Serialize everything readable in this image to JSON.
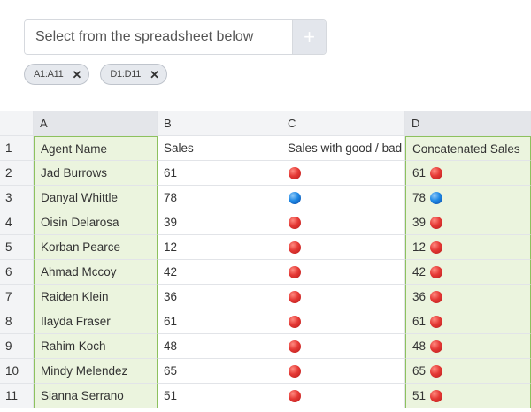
{
  "selector": {
    "placeholder": "Select from the spreadsheet below",
    "add_label": "+"
  },
  "chips": [
    {
      "label": "A1:A11"
    },
    {
      "label": "D1:D11"
    }
  ],
  "columns": [
    "A",
    "B",
    "C",
    "D"
  ],
  "colors": {
    "highlight_fill": "#ebf4de",
    "highlight_border": "#8dc15e",
    "bad": "#e53935",
    "good": "#1e88e5"
  },
  "rows": [
    {
      "num": "1",
      "a": "Agent Name",
      "b": "Sales",
      "c": "Sales with good / bad",
      "d": "Concatenated Sales",
      "icon": ""
    },
    {
      "num": "2",
      "a": "Jad Burrows",
      "b": "61",
      "c": "",
      "d": "61",
      "icon": "red-circle-icon"
    },
    {
      "num": "3",
      "a": "Danyal Whittle",
      "b": "78",
      "c": "",
      "d": "78",
      "icon": "blue-circle-icon"
    },
    {
      "num": "4",
      "a": "Oisin Delarosa",
      "b": "39",
      "c": "",
      "d": "39",
      "icon": "red-circle-icon"
    },
    {
      "num": "5",
      "a": "Korban Pearce",
      "b": "12",
      "c": "",
      "d": "12",
      "icon": "red-circle-icon"
    },
    {
      "num": "6",
      "a": "Ahmad Mccoy",
      "b": "42",
      "c": "",
      "d": "42",
      "icon": "red-circle-icon"
    },
    {
      "num": "7",
      "a": "Raiden Klein",
      "b": "36",
      "c": "",
      "d": "36",
      "icon": "red-circle-icon"
    },
    {
      "num": "8",
      "a": "Ilayda Fraser",
      "b": "61",
      "c": "",
      "d": "61",
      "icon": "red-circle-icon"
    },
    {
      "num": "9",
      "a": "Rahim Koch",
      "b": "48",
      "c": "",
      "d": "48",
      "icon": "red-circle-icon"
    },
    {
      "num": "10",
      "a": "Mindy Melendez",
      "b": "65",
      "c": "",
      "d": "65",
      "icon": "red-circle-icon"
    },
    {
      "num": "11",
      "a": "Sianna Serrano",
      "b": "51",
      "c": "",
      "d": "51",
      "icon": "red-circle-icon"
    }
  ]
}
